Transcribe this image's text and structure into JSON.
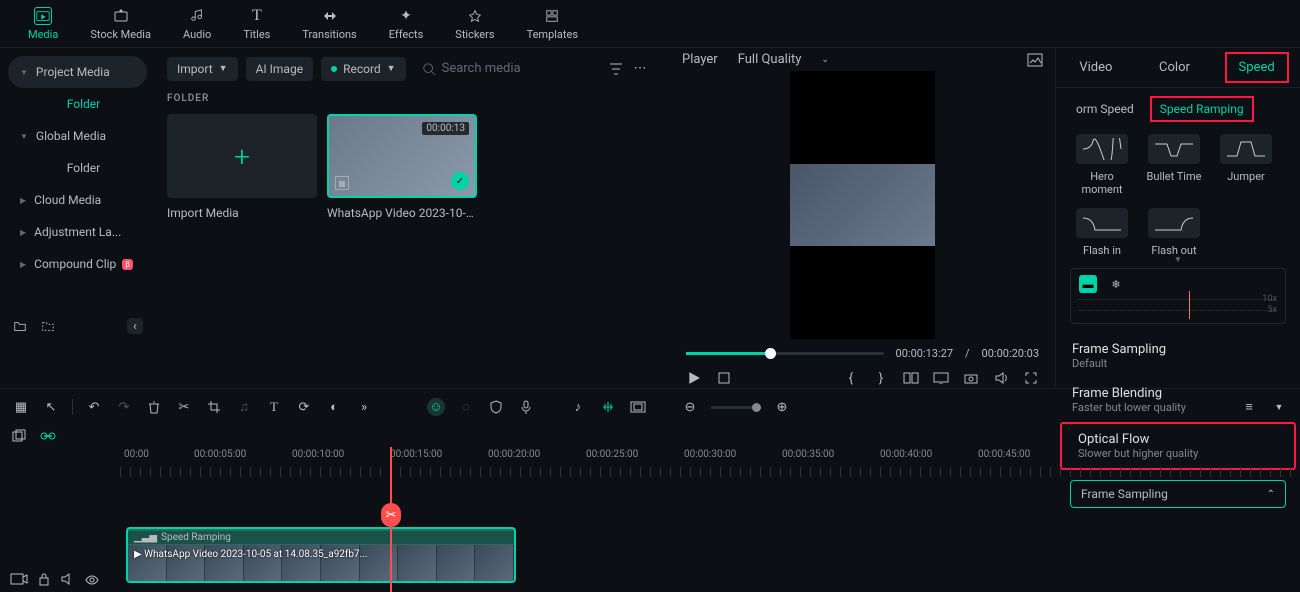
{
  "toolbar": {
    "media": "Media",
    "stock": "Stock Media",
    "audio": "Audio",
    "titles": "Titles",
    "transitions": "Transitions",
    "effects": "Effects",
    "stickers": "Stickers",
    "templates": "Templates"
  },
  "sidebar": {
    "project_media": "Project Media",
    "folder": "Folder",
    "global_media": "Global Media",
    "folder2": "Folder",
    "cloud_media": "Cloud Media",
    "adjustment": "Adjustment La...",
    "compound": "Compound Clip"
  },
  "media_browser": {
    "import": "Import",
    "ai_image": "AI Image",
    "record": "Record",
    "search_placeholder": "Search media",
    "folder_label": "FOLDER",
    "import_media": "Import Media",
    "clip_name": "WhatsApp Video 2023-10-05...",
    "clip_dur": "00:00:13"
  },
  "player": {
    "label": "Player",
    "quality": "Full Quality",
    "cur_time": "00:00:13:27",
    "total_time": "00:00:20:03",
    "sep": "/"
  },
  "right": {
    "tabs": {
      "video": "Video",
      "color": "Color",
      "speed": "Speed"
    },
    "subtabs": {
      "uniform": "orm Speed",
      "ramping": "Speed Ramping"
    },
    "presets": {
      "hero": "Hero moment",
      "bullet": "Bullet Time",
      "jumper": "Jumper",
      "flashin": "Flash in",
      "flashout": "Flash out"
    },
    "ramp": {
      "x10": "10x",
      "x5": "5x"
    },
    "frame_sampling": {
      "title": "Frame Sampling",
      "sub": "Default"
    },
    "frame_blending": {
      "title": "Frame Blending",
      "sub": "Faster but lower quality"
    },
    "optical_flow": {
      "title": "Optical Flow",
      "sub": "Slower but higher quality"
    },
    "select_value": "Frame Sampling"
  },
  "timeline": {
    "marks": [
      "00:00",
      "00:00:05:00",
      "00:00:10:00",
      "00:00:15:00",
      "00:00:20:00",
      "00:00:25:00",
      "00:00:30:00",
      "00:00:35:00",
      "00:00:40:00",
      "00:00:45:00"
    ],
    "clip_label": "Speed Ramping",
    "clip_name": "WhatsApp Video 2023-10-05 at 14.08.35_a92fb7..."
  }
}
